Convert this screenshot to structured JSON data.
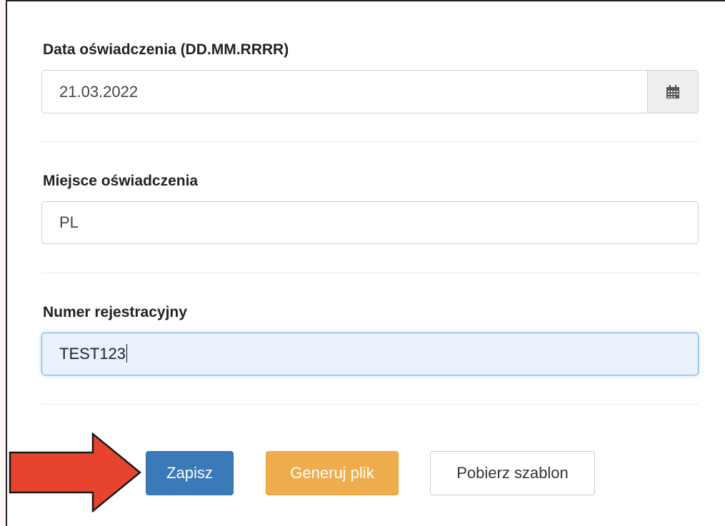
{
  "form": {
    "date": {
      "label": "Data oświadczenia (DD.MM.RRRR)",
      "value": "21.03.2022",
      "addon_icon": "calendar-icon"
    },
    "place": {
      "label": "Miejsce oświadczenia",
      "value": "PL"
    },
    "registration": {
      "label": "Numer rejestracyjny",
      "value": "TEST123",
      "focused": true
    }
  },
  "actions": {
    "save_label": "Zapisz",
    "generate_label": "Generuj plik",
    "template_label": "Pobierz szablon"
  },
  "annotation": {
    "arrow_icon": "red-arrow-icon",
    "arrow_color": "#e8432e"
  },
  "colors": {
    "primary": "#3a7ab8",
    "warning": "#f0ad4e",
    "focus_bg": "#e9f1fc"
  }
}
